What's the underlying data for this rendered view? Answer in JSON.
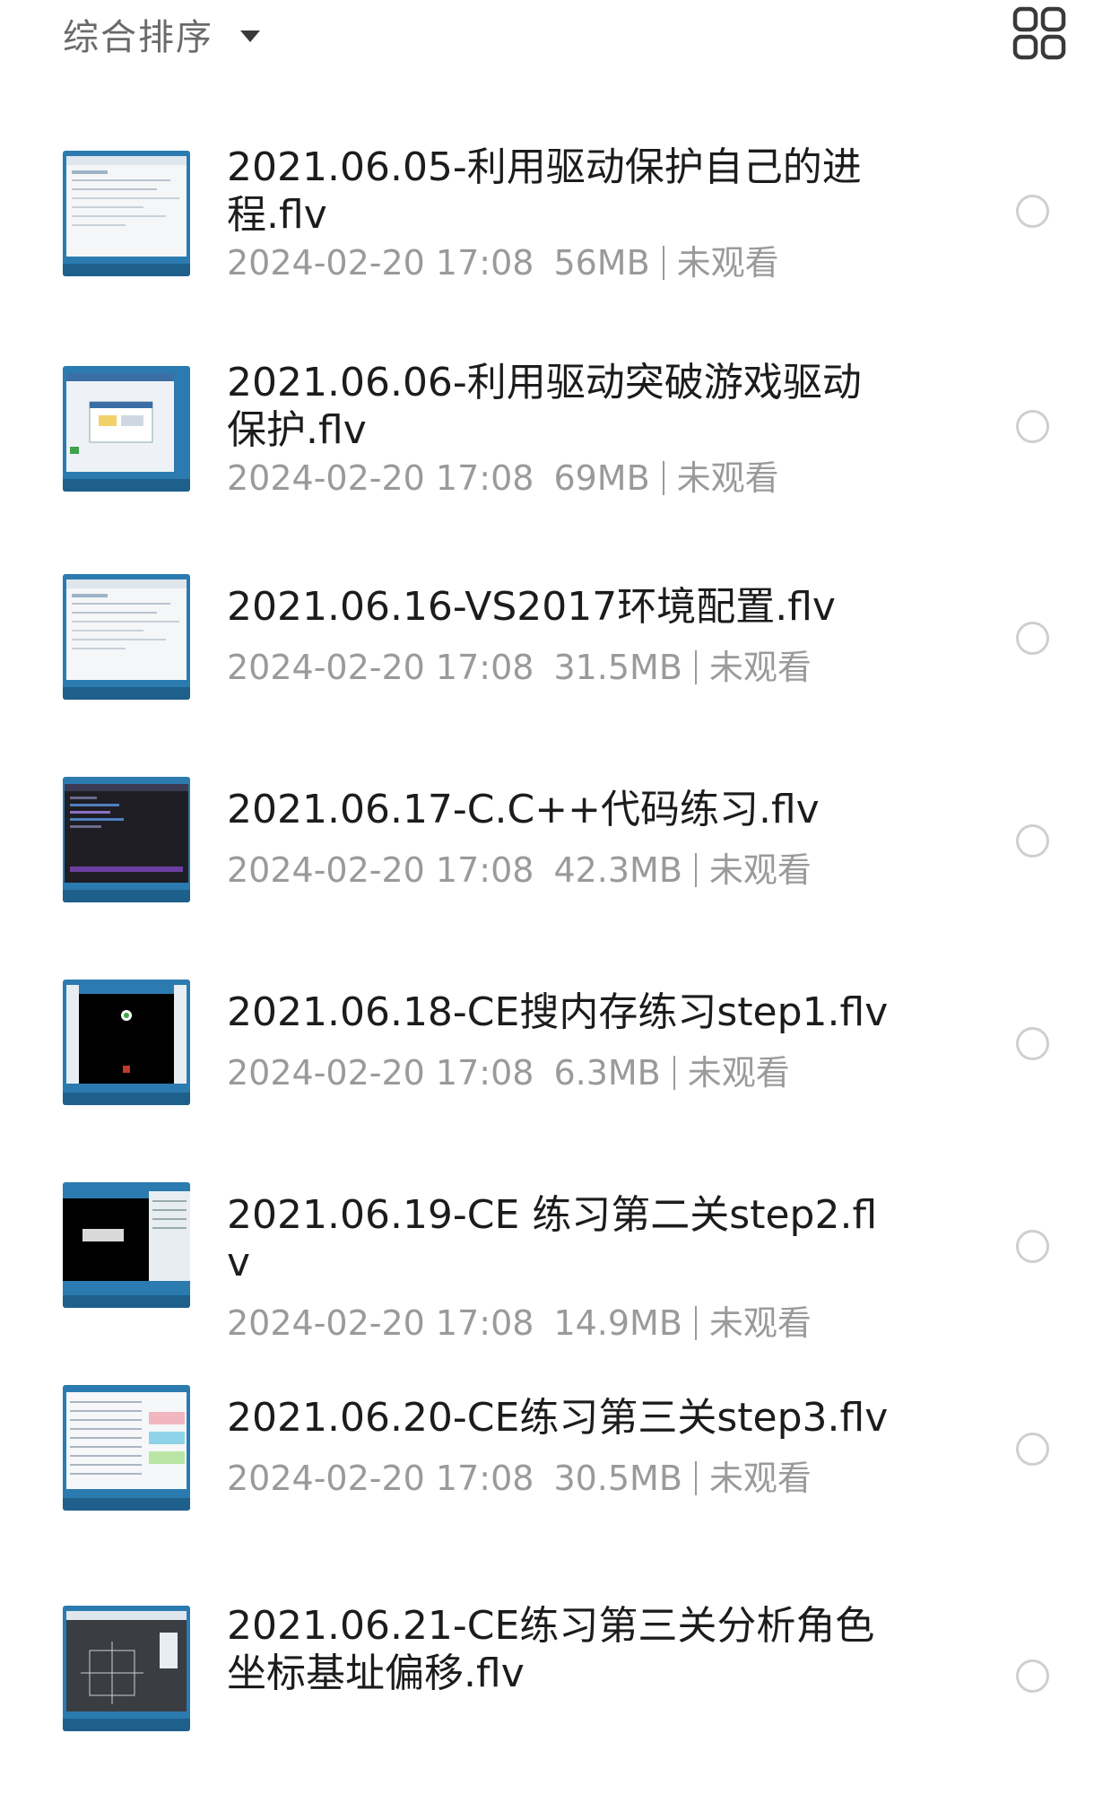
{
  "header": {
    "sort_label": "综合排序",
    "sort_caret_icon": "caret-down-icon",
    "view_toggle_icon": "grid-view-icon"
  },
  "files": [
    {
      "title": "2021.06.05-利用驱动保护自己的进程.flv",
      "date": "2024-02-20 17:08",
      "size": "56MB",
      "status": "未观看",
      "thumb": "light"
    },
    {
      "title": "2021.06.06-利用驱动突破游戏驱动保护.flv",
      "date": "2024-02-20 17:08",
      "size": "69MB",
      "status": "未观看",
      "thumb": "dialog"
    },
    {
      "title": "2021.06.16-VS2017环境配置.flv",
      "date": "2024-02-20 17:08",
      "size": "31.5MB",
      "status": "未观看",
      "thumb": "light"
    },
    {
      "title": "2021.06.17-C.C++代码练习.flv",
      "date": "2024-02-20 17:08",
      "size": "42.3MB",
      "status": "未观看",
      "thumb": "dark"
    },
    {
      "title": "2021.06.18-CE搜内存练习step1.flv",
      "date": "2024-02-20 17:08",
      "size": "6.3MB",
      "status": "未观看",
      "thumb": "black"
    },
    {
      "title": "2021.06.19-CE 练习第二关step2.flv",
      "date": "2024-02-20 17:08",
      "size": "14.9MB",
      "status": "未观看",
      "thumb": "black-split"
    },
    {
      "title": "2021.06.20-CE练习第三关step3.flv",
      "date": "2024-02-20 17:08",
      "size": "30.5MB",
      "status": "未观看",
      "thumb": "table"
    },
    {
      "title": "2021.06.21-CE练习第三关分析角色坐标基址偏移.flv",
      "date": "",
      "size": "",
      "status": "",
      "thumb": "cad"
    }
  ],
  "colors": {
    "title_text": "#1c1c1c",
    "meta_text": "#9a9a9a",
    "circle_border": "#cfcfcf",
    "desktop_blue": "#2b7bb0"
  }
}
